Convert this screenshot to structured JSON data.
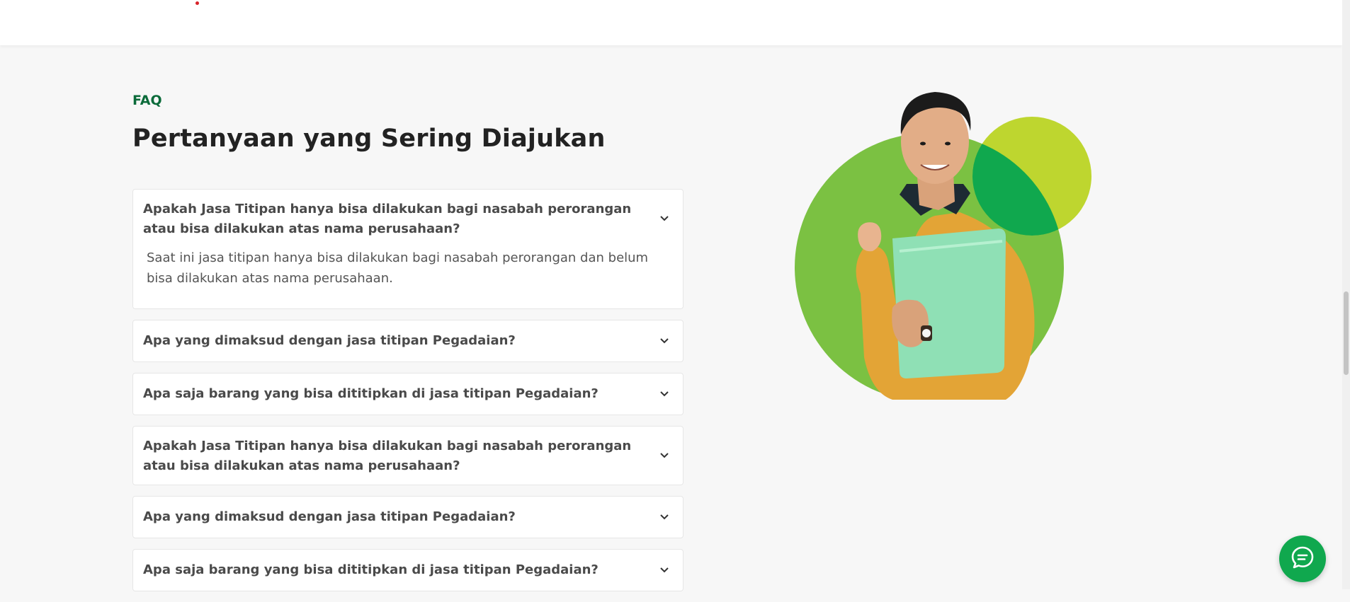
{
  "faq": {
    "eyebrow": "FAQ",
    "title": "Pertanyaan yang Sering Diajukan",
    "items": [
      {
        "question": "Apakah Jasa Titipan hanya bisa dilakukan bagi nasabah perorangan atau bisa dilakukan atas nama perusahaan?",
        "answer": "Saat ini jasa titipan hanya bisa dilakukan bagi nasabah perorangan dan belum bisa dilakukan atas nama perusahaan.",
        "expanded": true
      },
      {
        "question": "Apa yang dimaksud dengan jasa titipan Pegadaian?",
        "expanded": false
      },
      {
        "question": "Apa saja barang yang bisa dititipkan di jasa titipan Pegadaian?",
        "expanded": false
      },
      {
        "question": "Apakah Jasa Titipan hanya bisa dilakukan bagi nasabah perorangan atau bisa dilakukan atas nama perusahaan?",
        "expanded": false
      },
      {
        "question": "Apa yang dimaksud dengan jasa titipan Pegadaian?",
        "expanded": false
      },
      {
        "question": "Apa saja barang yang bisa dititipkan di jasa titipan Pegadaian?",
        "expanded": false
      }
    ]
  },
  "icons": {
    "chevron": "chevron-down-icon",
    "chat": "chat-icon"
  },
  "colors": {
    "brand_green": "#10a84e",
    "eyebrow_green": "#0b6b3a",
    "circle_green": "#7bc142",
    "circle_lime": "#bed62f",
    "overlap_green": "#10a84e",
    "sweater": "#e3a436",
    "folder": "#8fe0b5"
  }
}
